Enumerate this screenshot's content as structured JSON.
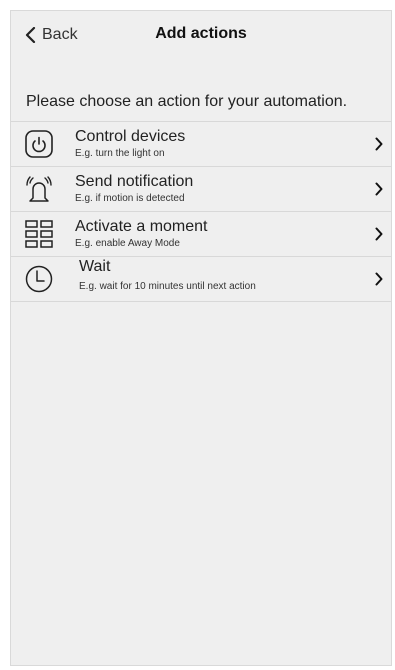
{
  "header": {
    "back_label": "Back",
    "title": "Add actions"
  },
  "instruction": "Please choose an action for your automation.",
  "actions": [
    {
      "icon": "power-icon",
      "title": "Control devices",
      "subtitle": "E.g. turn the light on"
    },
    {
      "icon": "bell-ringing-icon",
      "title": "Send notification",
      "subtitle": "E.g. if motion is detected"
    },
    {
      "icon": "grid-moment-icon",
      "title": "Activate a moment",
      "subtitle": "E.g. enable Away Mode"
    },
    {
      "icon": "clock-icon",
      "title": "Wait",
      "subtitle": "E.g. wait for 10 minutes until next action"
    }
  ],
  "colors": {
    "background": "#efefef",
    "divider": "#d8d8d8",
    "text": "#222222"
  }
}
